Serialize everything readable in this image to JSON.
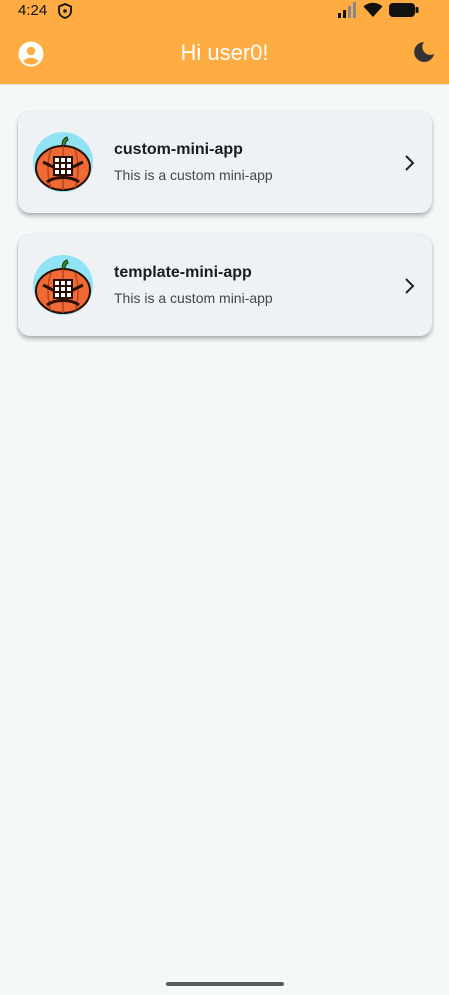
{
  "status_bar": {
    "time": "4:24"
  },
  "app_bar": {
    "title": "Hi user0!"
  },
  "apps": [
    {
      "title": "custom-mini-app",
      "description": "This is a custom mini-app"
    },
    {
      "title": "template-mini-app",
      "description": "This is a custom mini-app"
    }
  ],
  "icons": {
    "account": "account-circle-icon",
    "theme": "moon-icon",
    "chevron": "chevron-right-icon",
    "avatar": "pumpkin-icon"
  },
  "colors": {
    "app_bar": "#ffad42",
    "background": "#f4f8f9",
    "card": "#eef2f5",
    "pumpkin": "#f06a35",
    "avatar_bg": "#8fe3f5"
  }
}
